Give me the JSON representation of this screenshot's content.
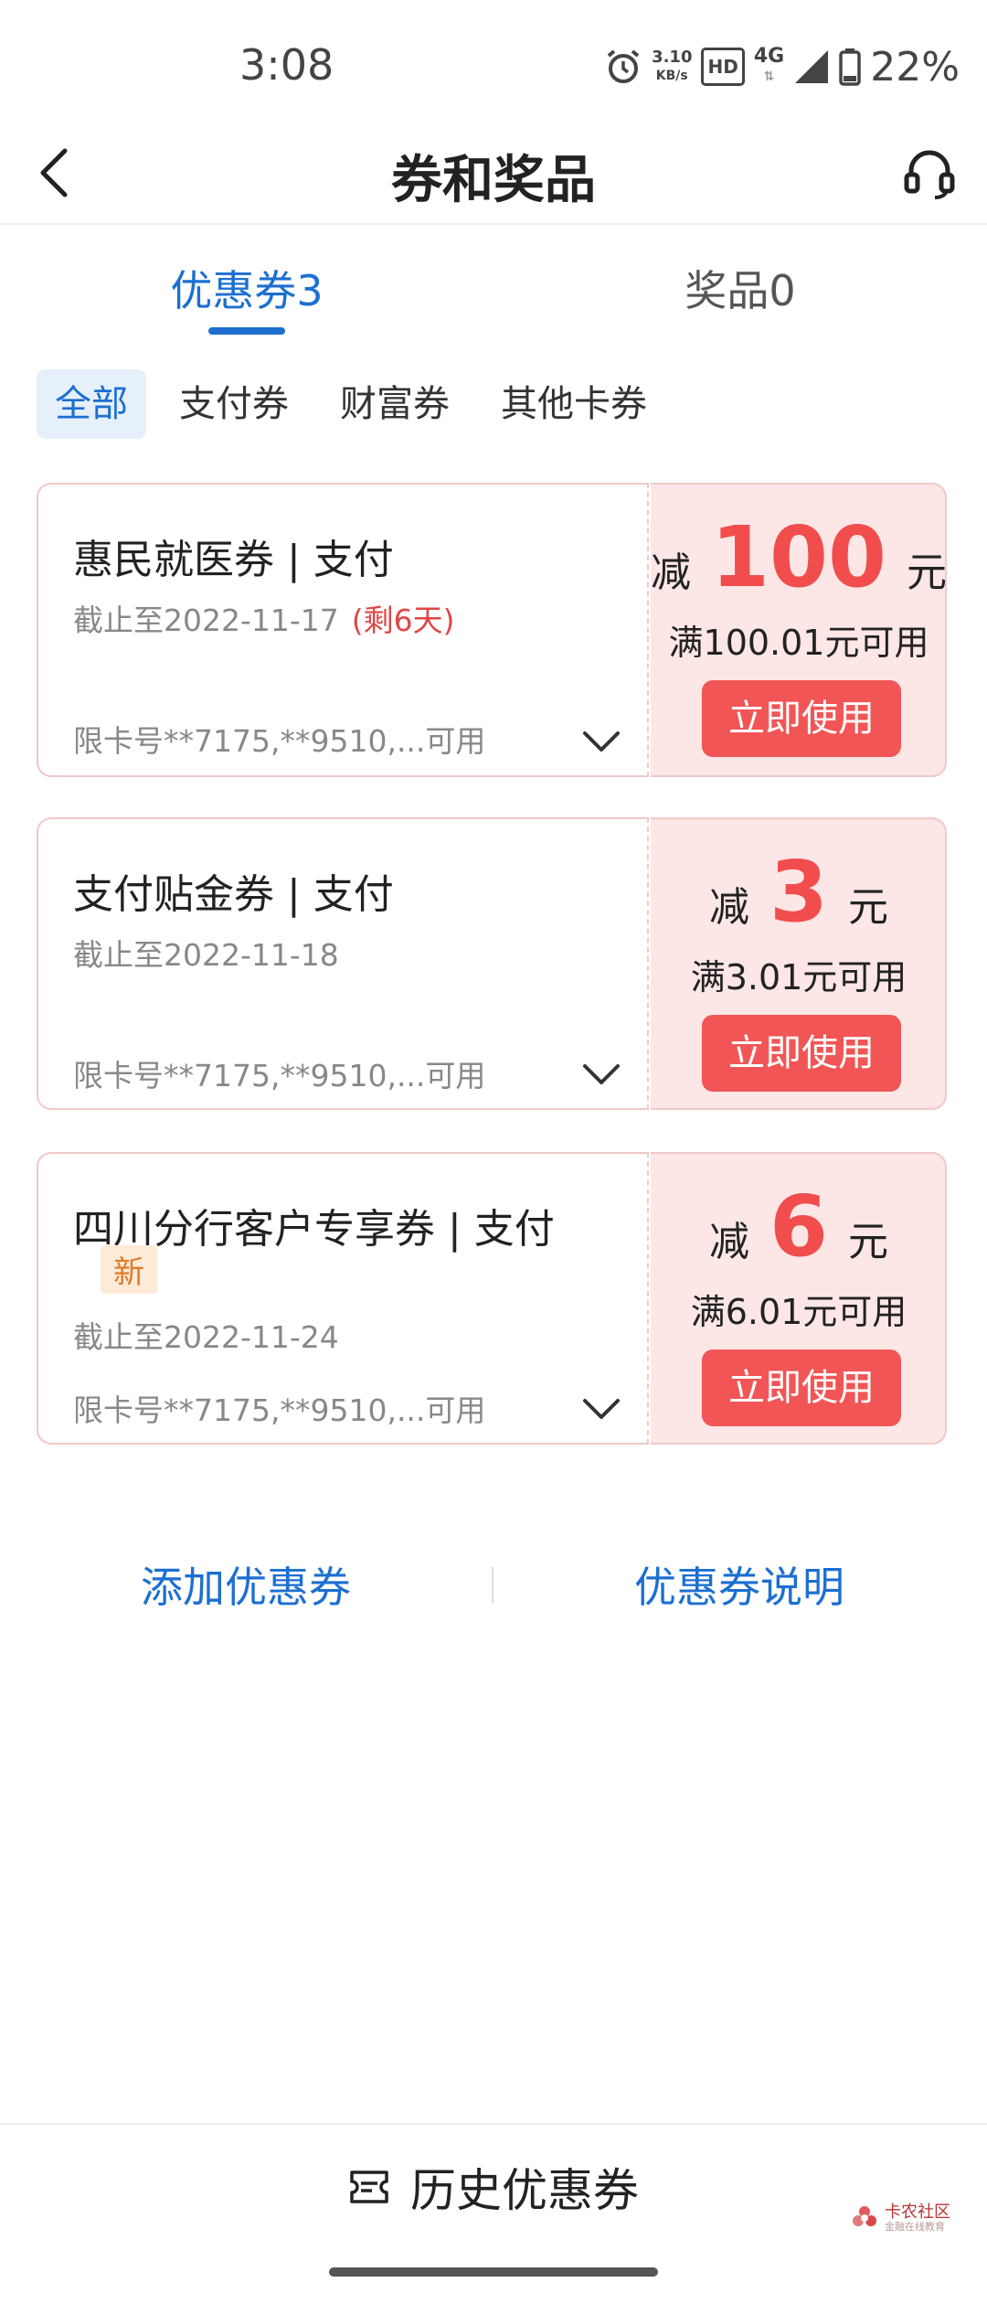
{
  "status_bar": {
    "time": "3:08",
    "speed_value": "3.10",
    "speed_unit": "KB/s",
    "hd_label": "HD",
    "network": "4G",
    "battery": "22%"
  },
  "header": {
    "title": "券和奖品"
  },
  "tabs": [
    {
      "label": "优惠券3"
    },
    {
      "label": "奖品0"
    }
  ],
  "filters": [
    {
      "label": "全部"
    },
    {
      "label": "支付券"
    },
    {
      "label": "财富券"
    },
    {
      "label": "其他卡券"
    }
  ],
  "coupons": [
    {
      "name": "惠民就医券 | 支付",
      "expire": "截止至2022-11-17",
      "remain": "(剩6天)",
      "limit": "限卡号**7175,**9510,...可用",
      "amount_prefix": "减",
      "amount": "100",
      "amount_unit": "元",
      "threshold": "满100.01元可用",
      "button": "立即使用"
    },
    {
      "name": "支付贴金券 | 支付",
      "expire": "截止至2022-11-18",
      "limit": "限卡号**7175,**9510,...可用",
      "amount_prefix": "减",
      "amount": "3",
      "amount_unit": "元",
      "threshold": "满3.01元可用",
      "button": "立即使用"
    },
    {
      "name": "四川分行客户专享券 | 支付",
      "badge": "新",
      "expire": "截止至2022-11-24",
      "limit": "限卡号**7175,**9510,...可用",
      "amount_prefix": "减",
      "amount": "6",
      "amount_unit": "元",
      "threshold": "满6.01元可用",
      "button": "立即使用"
    }
  ],
  "links": {
    "add": "添加优惠券",
    "explain": "优惠券说明"
  },
  "bottom": {
    "history": "历史优惠券"
  },
  "watermark": {
    "title": "卡农社区",
    "subtitle": "金融在线教育"
  },
  "colors": {
    "accent_blue": "#1c6fd1",
    "coupon_red": "#f24d4d",
    "button_red": "#f25555",
    "coupon_bg": "#fce6e6"
  }
}
